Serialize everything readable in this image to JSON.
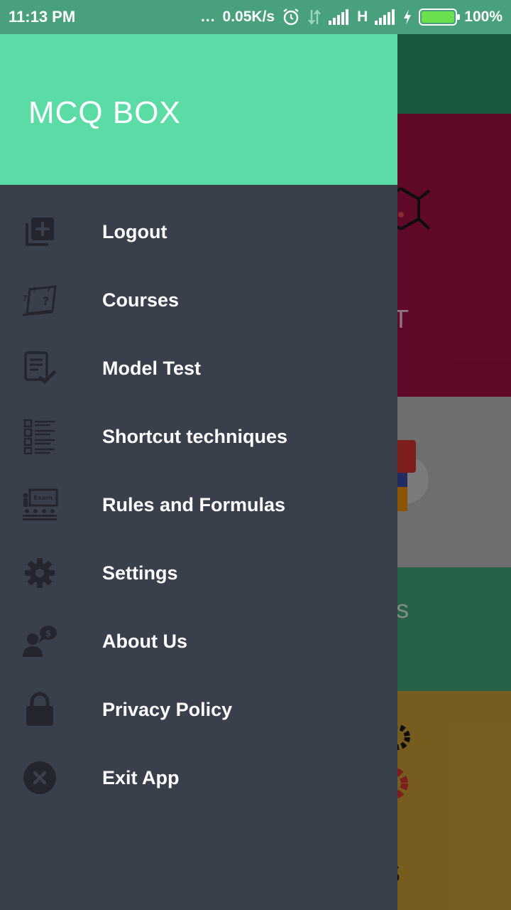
{
  "status_bar": {
    "time": "11:13 PM",
    "dots": "...",
    "speed": "0.05K/s",
    "network": "H",
    "battery_level": 100,
    "battery_text": "100%",
    "icons": [
      "alarm-icon",
      "data-arrows-icon",
      "signal-icon",
      "signal-icon",
      "charging-icon",
      "battery-icon"
    ]
  },
  "drawer": {
    "title": "MCQ BOX",
    "items": [
      {
        "label": "Logout",
        "icon": "add-box-icon"
      },
      {
        "label": "Courses",
        "icon": "courses-icon"
      },
      {
        "label": "Model Test",
        "icon": "test-checklist-icon"
      },
      {
        "label": "Shortcut techniques",
        "icon": "list-icon"
      },
      {
        "label": "Rules and Formulas",
        "icon": "classroom-icon"
      },
      {
        "label": "Settings",
        "icon": "gear-icon"
      },
      {
        "label": "About Us",
        "icon": "person-speech-icon"
      },
      {
        "label": "Privacy Policy",
        "icon": "lock-icon"
      },
      {
        "label": "Exit App",
        "icon": "close-circle-icon"
      }
    ]
  },
  "background_tiles": [
    {
      "label": "LIST"
    },
    {
      "label": ""
    },
    {
      "label": "ques"
    },
    {
      "label": "GS"
    }
  ],
  "colors": {
    "drawer_bg": "#3a3f4c",
    "header_bg": "#5bdca6",
    "status_bg": "#48a07c",
    "icon_color": "#23262e"
  }
}
